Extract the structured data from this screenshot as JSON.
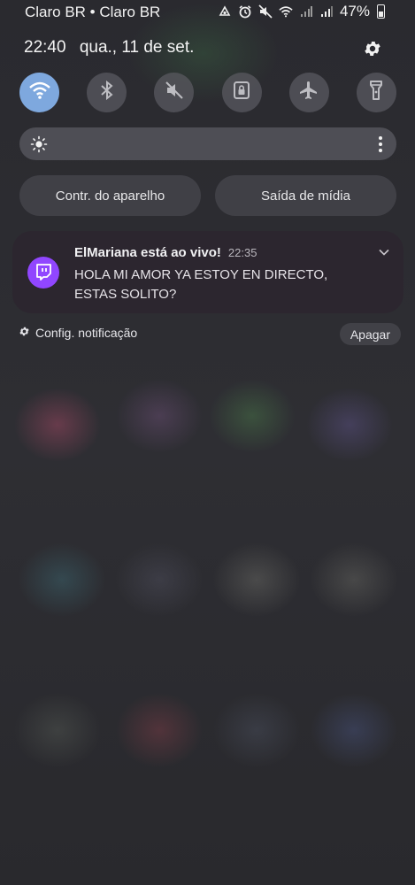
{
  "status_bar": {
    "carrier": "Claro BR • Claro BR",
    "battery": "47%",
    "icons": [
      "vpn-icon",
      "alarm-icon",
      "mute-icon",
      "wifi-icon",
      "signal-icon",
      "signal-icon",
      "battery-icon"
    ]
  },
  "header": {
    "time": "22:40",
    "date": "qua., 11 de set.",
    "settings_icon": "gear-icon"
  },
  "quick_toggles": [
    {
      "icon": "wifi-icon",
      "active": true
    },
    {
      "icon": "bluetooth-icon",
      "active": false
    },
    {
      "icon": "sound-off-icon",
      "active": false
    },
    {
      "icon": "rotation-lock-icon",
      "active": false
    },
    {
      "icon": "airplane-icon",
      "active": false
    },
    {
      "icon": "flashlight-icon",
      "active": false
    }
  ],
  "brightness": {
    "icon": "sun-icon",
    "menu_icon": "more-vertical-icon"
  },
  "buttons": {
    "device_control": "Contr. do aparelho",
    "media_output": "Saída de mídia"
  },
  "notification": {
    "app_icon": "twitch-icon",
    "title": "ElMariana está ao vivo!",
    "time": "22:35",
    "body": "HOLA MI AMOR YA ESTOY EN DIRECTO, ESTAS SOLITO?",
    "accent": "#9146ff"
  },
  "footer": {
    "settings_label": "Config. notificação",
    "clear_label": "Apagar"
  },
  "colors": {
    "wifi_active": "#7ea8de",
    "panel_bg": "#2c2c31"
  }
}
